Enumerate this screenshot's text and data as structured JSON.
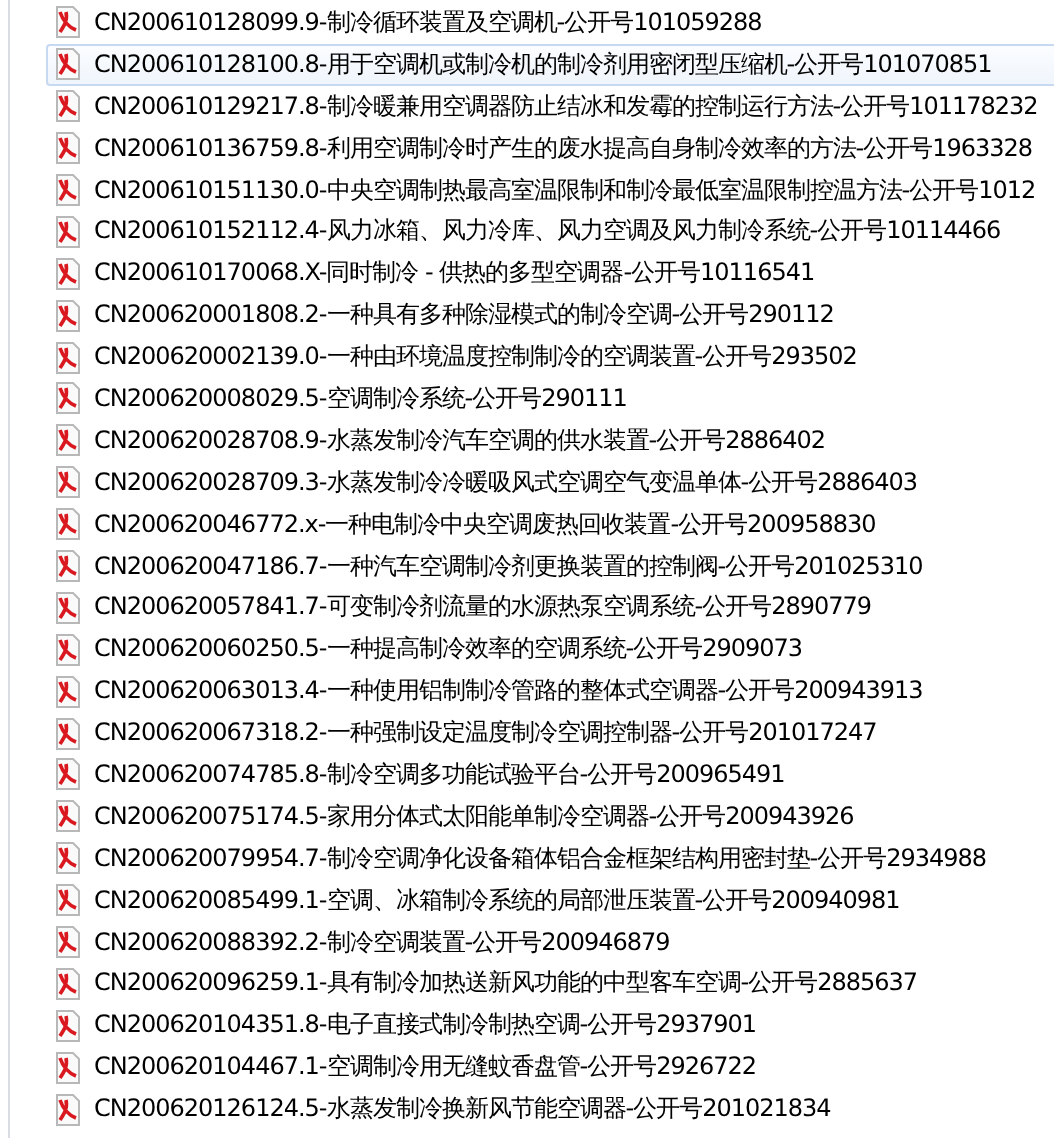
{
  "files": [
    {
      "name": "CN200610128099.9-制冷循环装置及空调机-公开号101059288",
      "selected": false
    },
    {
      "name": "CN200610128100.8-用于空调机或制冷机的制冷剂用密闭型压缩机-公开号101070851",
      "selected": true
    },
    {
      "name": "CN200610129217.8-制冷暖兼用空调器防止结冰和发霉的控制运行方法-公开号101178232",
      "selected": false
    },
    {
      "name": "CN200610136759.8-利用空调制冷时产生的废水提高自身制冷效率的方法-公开号1963328",
      "selected": false
    },
    {
      "name": "CN200610151130.0-中央空调制热最高室温限制和制冷最低室温限制控温方法-公开号1012",
      "selected": false
    },
    {
      "name": "CN200610152112.4-风力冰箱、风力冷库、风力空调及风力制冷系统-公开号10114466",
      "selected": false
    },
    {
      "name": "CN200610170068.X-同时制冷 - 供热的多型空调器-公开号10116541",
      "selected": false
    },
    {
      "name": "CN200620001808.2-一种具有多种除湿模式的制冷空调-公开号290112",
      "selected": false
    },
    {
      "name": "CN200620002139.0-一种由环境温度控制制冷的空调装置-公开号293502",
      "selected": false
    },
    {
      "name": "CN200620008029.5-空调制冷系统-公开号290111",
      "selected": false
    },
    {
      "name": "CN200620028708.9-水蒸发制冷汽车空调的供水装置-公开号2886402",
      "selected": false
    },
    {
      "name": "CN200620028709.3-水蒸发制冷冷暖吸风式空调空气变温单体-公开号2886403",
      "selected": false
    },
    {
      "name": "CN200620046772.x-一种电制冷中央空调废热回收装置-公开号200958830",
      "selected": false
    },
    {
      "name": "CN200620047186.7-一种汽车空调制冷剂更换装置的控制阀-公开号201025310",
      "selected": false
    },
    {
      "name": "CN200620057841.7-可变制冷剂流量的水源热泵空调系统-公开号2890779",
      "selected": false
    },
    {
      "name": "CN200620060250.5-一种提高制冷效率的空调系统-公开号2909073",
      "selected": false
    },
    {
      "name": "CN200620063013.4-一种使用铝制制冷管路的整体式空调器-公开号200943913",
      "selected": false
    },
    {
      "name": "CN200620067318.2-一种强制设定温度制冷空调控制器-公开号201017247",
      "selected": false
    },
    {
      "name": "CN200620074785.8-制冷空调多功能试验平台-公开号200965491",
      "selected": false
    },
    {
      "name": "CN200620075174.5-家用分体式太阳能单制冷空调器-公开号200943926",
      "selected": false
    },
    {
      "name": "CN200620079954.7-制冷空调净化设备箱体铝合金框架结构用密封垫-公开号2934988",
      "selected": false
    },
    {
      "name": "CN200620085499.1-空调、冰箱制冷系统的局部泄压装置-公开号200940981",
      "selected": false
    },
    {
      "name": "CN200620088392.2-制冷空调装置-公开号200946879",
      "selected": false
    },
    {
      "name": "CN200620096259.1-具有制冷加热送新风功能的中型客车空调-公开号2885637",
      "selected": false
    },
    {
      "name": "CN200620104351.8-电子直接式制冷制热空调-公开号2937901",
      "selected": false
    },
    {
      "name": "CN200620104467.1-空调制冷用无缝蚊香盘管-公开号2926722",
      "selected": false
    },
    {
      "name": "CN200620126124.5-水蒸发制冷换新风节能空调器-公开号201021834",
      "selected": false
    }
  ]
}
